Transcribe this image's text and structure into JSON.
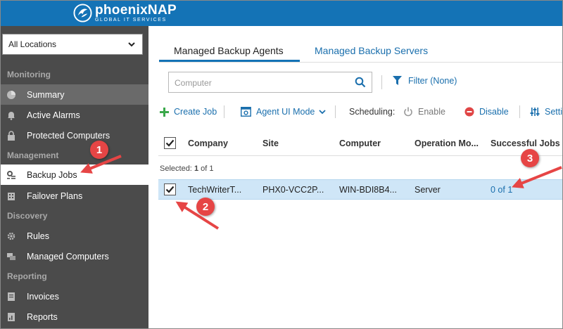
{
  "brand": {
    "name": "phoenixNAP",
    "tagline": "GLOBAL IT SERVICES"
  },
  "sidebar": {
    "location_select": "All Locations",
    "sections": {
      "monitoring": "Monitoring",
      "management": "Management",
      "discovery": "Discovery",
      "reporting": "Reporting"
    },
    "items": [
      {
        "label": "Summary",
        "icon": "pie-chart-icon"
      },
      {
        "label": "Active Alarms",
        "icon": "bell-icon"
      },
      {
        "label": "Protected Computers",
        "icon": "lock-icon"
      },
      {
        "label": "Backup Jobs",
        "icon": "gear-list-icon"
      },
      {
        "label": "Failover Plans",
        "icon": "building-icon"
      },
      {
        "label": "Rules",
        "icon": "gear-icon"
      },
      {
        "label": "Managed Computers",
        "icon": "computers-icon"
      },
      {
        "label": "Invoices",
        "icon": "invoice-icon"
      },
      {
        "label": "Reports",
        "icon": "report-icon"
      }
    ]
  },
  "tabs": [
    {
      "label": "Managed Backup Agents",
      "active": true
    },
    {
      "label": "Managed Backup Servers",
      "active": false
    }
  ],
  "search": {
    "placeholder": "Computer"
  },
  "filter": {
    "label": "Filter (None)"
  },
  "toolbar": {
    "create_job": "Create Job",
    "agent_ui_mode": "Agent UI Mode",
    "scheduling": "Scheduling:",
    "enable": "Enable",
    "disable": "Disable",
    "settings": "Setti"
  },
  "grid": {
    "columns": [
      "Company",
      "Site",
      "Computer",
      "Operation Mo...",
      "Successful Jobs"
    ],
    "selected_label": "Selected:",
    "selected_count": "1",
    "selected_of": "of 1",
    "rows": [
      {
        "company": "TechWriterT...",
        "site": "PHX0-VCC2P...",
        "computer": "WIN-BDI8B4...",
        "operation_mode": "Server",
        "successful_jobs": "0 of 1",
        "checked": true
      }
    ]
  },
  "callouts": [
    "1",
    "2",
    "3"
  ],
  "colors": {
    "header": "#1473b6",
    "sidebar": "#4b4b4b",
    "link": "#1a6fad",
    "row_selected": "#cfe6f7",
    "callout": "#e64545"
  }
}
